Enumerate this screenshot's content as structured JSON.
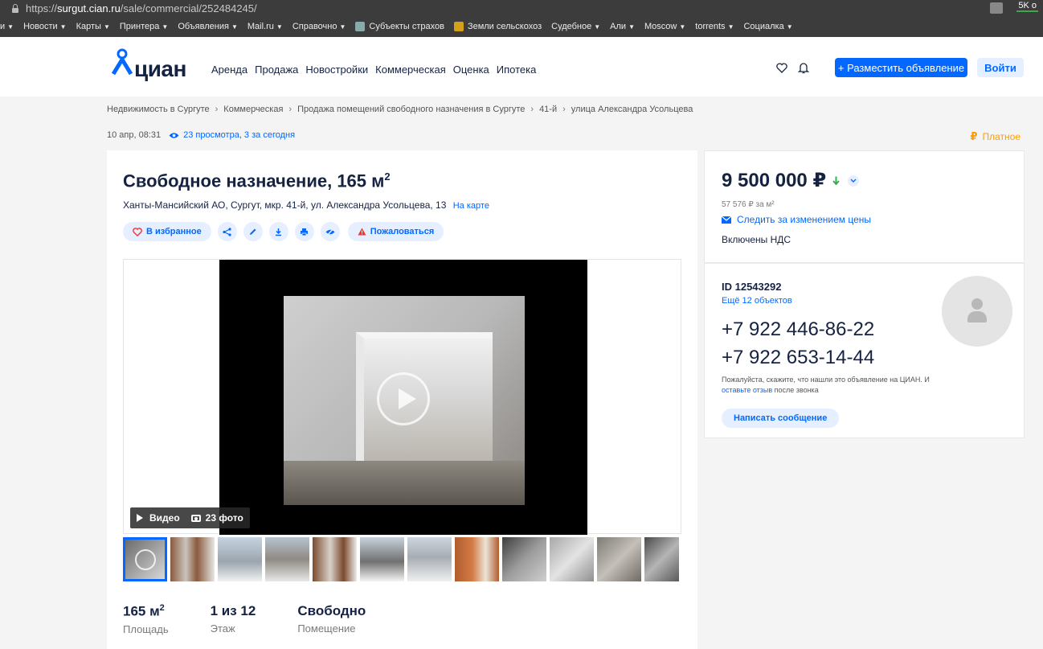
{
  "browser": {
    "url_prefix": "https://",
    "url_domain": "surgut.cian.ru",
    "url_path": "/sale/commercial/252484245/",
    "chat_badge": "5K о"
  },
  "bookmarks": [
    {
      "label": "и",
      "caret": true
    },
    {
      "label": "Новости",
      "caret": true
    },
    {
      "label": "Карты",
      "caret": true
    },
    {
      "label": "Принтера",
      "caret": true
    },
    {
      "label": "Объявления",
      "caret": true
    },
    {
      "label": "Mail.ru",
      "caret": true
    },
    {
      "label": "Справочно",
      "caret": true
    },
    {
      "label": "Субъекты страхов",
      "caret": false,
      "icon": "globe-icon"
    },
    {
      "label": "Земли сельскохоз",
      "caret": false,
      "icon": "map-icon"
    },
    {
      "label": "Судебное",
      "caret": true
    },
    {
      "label": "Али",
      "caret": true
    },
    {
      "label": "Moscow",
      "caret": true
    },
    {
      "label": "torrents",
      "caret": true
    },
    {
      "label": "Социалка",
      "caret": true
    }
  ],
  "header": {
    "logo_text": "циан",
    "nav": [
      "Аренда",
      "Продажа",
      "Новостройки",
      "Коммерческая",
      "Оценка",
      "Ипотека"
    ],
    "post_button": "+ Разместить объявление",
    "login_button": "Войти"
  },
  "breadcrumbs": [
    "Недвижимость в Сургуте",
    "Коммерческая",
    "Продажа помещений свободного назначения в Сургуте",
    "41-й",
    "улица Александра Усольцева"
  ],
  "meta": {
    "date": "10 апр, 08:31",
    "views": "23 просмотра, 3 за сегодня",
    "paid": "Платное"
  },
  "listing": {
    "title": "Свободное назначение, 165 м",
    "title_sup": "2",
    "address": "Ханты-Мансийский АО, Сургут, мкр. 41-й, ул. Александра Усольцева, 13",
    "map_link": "На карте",
    "favorite": "В избранное",
    "complain": "Пожаловаться",
    "video_label": "Видео",
    "photos_label": "23 фото",
    "stats": [
      {
        "value": "165 м",
        "sup": "2",
        "label": "Площадь"
      },
      {
        "value": "1 из 12",
        "sup": "",
        "label": "Этаж"
      },
      {
        "value": "Свободно",
        "sup": "",
        "label": "Помещение"
      }
    ]
  },
  "price": {
    "value": "9 500 000 ₽",
    "per_m": "57 576 ₽ за м²",
    "follow": "Следить за изменением цены",
    "vat": "Включены НДС"
  },
  "contact": {
    "id": "ID 12543292",
    "more": "Ещё 12 объектов",
    "phone1": "+7 922 446-86-22",
    "phone2": "+7 922 653-14-44",
    "note_a": "Пожалуйста, скажите, что нашли это объявление на ЦИАН. И ",
    "note_link": "оставьте отзыв",
    "note_b": " после звонка",
    "message_button": "Написать сообщение"
  },
  "colors": {
    "accent": "#0468ff",
    "accent_light": "#e6efff",
    "paid": "#ff9d00",
    "price_down": "#2fb34a",
    "complain": "#e33"
  }
}
